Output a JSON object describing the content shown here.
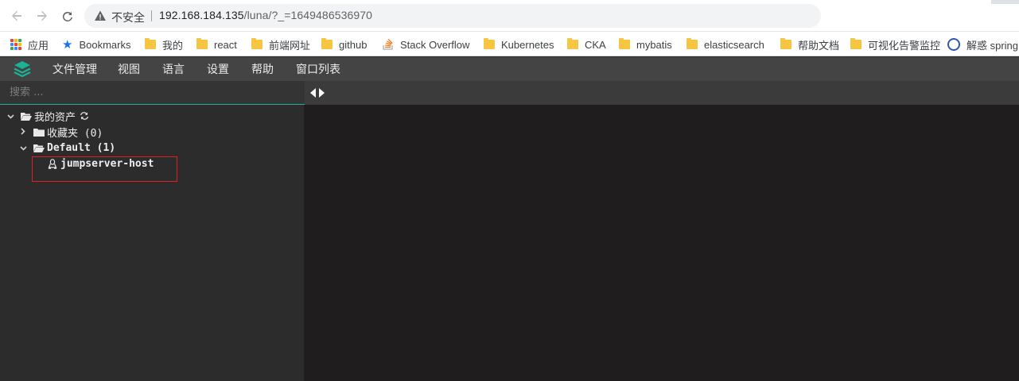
{
  "browser": {
    "insecure_label": "不安全",
    "url_host": "192.168.184.135",
    "url_rest": "/luna/?_=1649486536970",
    "bookmarks": [
      {
        "label": "应用",
        "icon": "apps-icon"
      },
      {
        "label": "Bookmarks",
        "icon": "star-icon"
      },
      {
        "label": "我的",
        "icon": "folder-icon"
      },
      {
        "label": "react",
        "icon": "folder-icon"
      },
      {
        "label": "前端网址",
        "icon": "folder-icon"
      },
      {
        "label": "github",
        "icon": "folder-icon"
      },
      {
        "label": "Stack Overflow",
        "icon": "stackoverflow-icon"
      },
      {
        "label": "Kubernetes",
        "icon": "folder-icon"
      },
      {
        "label": "CKA",
        "icon": "folder-icon"
      },
      {
        "label": "mybatis",
        "icon": "folder-icon"
      },
      {
        "label": "elasticsearch",
        "icon": "folder-icon"
      },
      {
        "label": "帮助文档",
        "icon": "folder-icon"
      },
      {
        "label": "可视化告警监控",
        "icon": "folder-icon"
      },
      {
        "label": "解惑 spring",
        "icon": "extension-icon"
      }
    ]
  },
  "app": {
    "menu": [
      {
        "label": "文件管理"
      },
      {
        "label": "视图"
      },
      {
        "label": "语言"
      },
      {
        "label": "设置"
      },
      {
        "label": "帮助"
      },
      {
        "label": "窗口列表"
      }
    ],
    "search": {
      "placeholder": "搜索 ..."
    },
    "tree": {
      "root_label": "我的资产",
      "favorites_label": "收藏夹 (0)",
      "default_label": "Default (1)",
      "host_label": "jumpserver-host"
    }
  },
  "colors": {
    "accent": "#1ab394",
    "highlight_box": "#e02020",
    "menu_bg": "#444444",
    "pane_bg": "#2c2c2c",
    "terminal_bg": "#1f1d1d"
  }
}
